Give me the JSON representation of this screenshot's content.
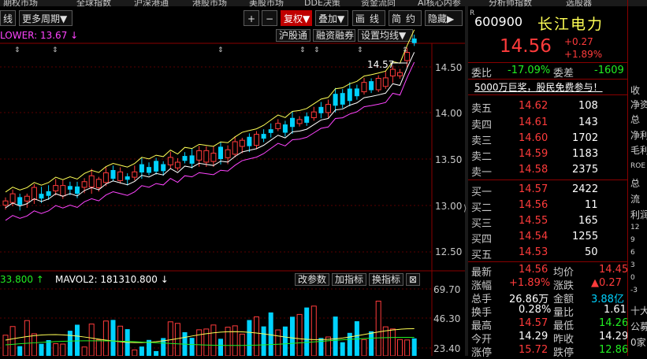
{
  "top_menu": [
    "期权市场",
    "全球指数",
    "沪深港通",
    "港股市场",
    "美股市场",
    "DDE决策",
    "资金流向",
    "AI核心内参",
    "分析师指数",
    "选股器"
  ],
  "toolbar": {
    "period": "线",
    "more_period": "更多周期▼",
    "zoom_in": "+",
    "zoom_out": "−",
    "restore": "复权▼",
    "overlay": "叠加▼",
    "draw": "画线",
    "simple": "简约",
    "hide": "隐藏▶"
  },
  "chart_bar": {
    "indicator": "LOWER: 13.67 ↓",
    "hsgt": "沪股通",
    "margin": "融资融券",
    "ma_settings": "设置均线▼"
  },
  "price_axis": [
    "14.50",
    "14.00",
    "13.50",
    "13.00",
    "12.50"
  ],
  "vol_axis": [
    "69.70",
    "46.30",
    "23.40"
  ],
  "peak_label": "14.57",
  "volume_bar": {
    "mavol1": "33.800 ↑",
    "mavol2": "MAVOL2: 181310.800 ↓",
    "change_param": "改参数",
    "add_indicator": "加指标",
    "switch_indicator": "换指标",
    "close": "⊠"
  },
  "quote": {
    "r_mark": "R",
    "code": "600900",
    "name": "长江电力",
    "price": "14.56",
    "change": "+0.27",
    "change_pct": "+1.89%",
    "webi_label": "委比",
    "webi": "-17.09%",
    "weicha_label": "委差",
    "weicha": "-1609",
    "ad": "5000万巨奖，股民免费参与！",
    "asks": [
      {
        "label": "卖五",
        "price": "14.62",
        "vol": "108"
      },
      {
        "label": "卖四",
        "price": "14.61",
        "vol": "143"
      },
      {
        "label": "卖三",
        "price": "14.60",
        "vol": "1702"
      },
      {
        "label": "卖二",
        "price": "14.59",
        "vol": "1183"
      },
      {
        "label": "卖一",
        "price": "14.58",
        "vol": "2375"
      }
    ],
    "bids": [
      {
        "label": "买一",
        "price": "14.57",
        "vol": "2422"
      },
      {
        "label": "买二",
        "price": "14.56",
        "vol": "11"
      },
      {
        "label": "买三",
        "price": "14.55",
        "vol": "165"
      },
      {
        "label": "买四",
        "price": "14.54",
        "vol": "1255"
      },
      {
        "label": "买五",
        "price": "14.53",
        "vol": "50"
      }
    ],
    "stats": [
      {
        "l1": "最新",
        "v1": "14.56",
        "l2": "均价",
        "v2": "14.45"
      },
      {
        "l1": "涨幅",
        "v1": "+1.89%",
        "l2": "涨跌",
        "v2": "▲0.27"
      },
      {
        "l1": "总手",
        "v1": "26.86万",
        "l2": "金额",
        "v2": "3.88亿"
      },
      {
        "l1": "换手",
        "v1": "0.28%",
        "l2": "量比",
        "v2": "1.61"
      },
      {
        "l1": "最高",
        "v1": "14.57",
        "l2": "最低",
        "v2": "14.26"
      },
      {
        "l1": "今开",
        "v1": "14.29",
        "l2": "昨收",
        "v2": "14.29"
      },
      {
        "l1": "涨停",
        "v1": "15.72",
        "l2": "跌停",
        "v2": "12.86"
      }
    ]
  },
  "side_clip": [
    "收",
    "净资",
    "总",
    "净利",
    "毛利",
    "ROE",
    "总",
    "流",
    "利润",
    "12",
    "9",
    "6",
    "3",
    "0",
    "-3",
    "十大",
    "公募",
    "0家"
  ],
  "colors": {
    "up": "#ff3b3b",
    "down": "#00d2ff",
    "yellow": "#ffff55",
    "magenta": "#ff44ff",
    "white": "#ffffff",
    "gray": "#c8c8c8",
    "green": "#22ee22"
  }
}
